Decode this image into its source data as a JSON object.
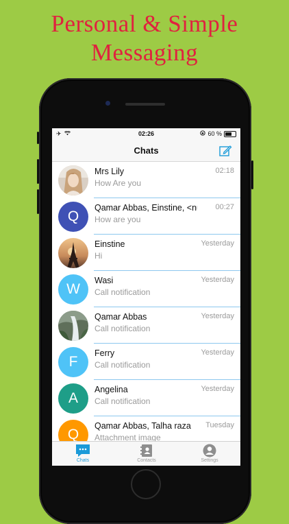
{
  "headline": {
    "line1": "Personal & Simple",
    "line2": "Messaging"
  },
  "status": {
    "time": "02:26",
    "battery": "60 %"
  },
  "nav": {
    "title": "Chats",
    "compose_icon": "compose-icon"
  },
  "chats": [
    {
      "name": "Mrs Lily",
      "time": "02:18",
      "message": "How Are you",
      "avatar_type": "photo-woman",
      "initial": ""
    },
    {
      "name": "Qamar Abbas, Einstine, <nul...",
      "time": "00:27",
      "message": "How are you",
      "avatar_type": "letter",
      "initial": "Q",
      "color": "#3f51b5"
    },
    {
      "name": "Einstine",
      "time": "Yesterday",
      "message": "Hi",
      "avatar_type": "photo-tower",
      "initial": ""
    },
    {
      "name": "Wasi",
      "time": "Yesterday",
      "message": "Call notification",
      "avatar_type": "letter",
      "initial": "W",
      "color": "#4fc3f7"
    },
    {
      "name": "Qamar Abbas",
      "time": "Yesterday",
      "message": "Call notification",
      "avatar_type": "photo-waterfall",
      "initial": ""
    },
    {
      "name": "Ferry",
      "time": "Yesterday",
      "message": "Call notification",
      "avatar_type": "letter",
      "initial": "F",
      "color": "#4fc3f7"
    },
    {
      "name": "Angelina",
      "time": "Yesterday",
      "message": "Call notification",
      "avatar_type": "letter",
      "initial": "A",
      "color": "#1e9e88"
    },
    {
      "name": "Qamar Abbas, Talha raza",
      "time": "Tuesday",
      "message": "Attachment image",
      "avatar_type": "letter",
      "initial": "Q",
      "color": "#ff9800"
    }
  ],
  "tabs": [
    {
      "label": "Chats",
      "icon": "chat-bubble-icon",
      "active": true
    },
    {
      "label": "Contacts",
      "icon": "contacts-book-icon",
      "active": false
    },
    {
      "label": "Settings",
      "icon": "person-circle-icon",
      "active": false
    }
  ],
  "colors": {
    "background": "#9dcb45",
    "headline": "#e0223f",
    "accent": "#1b9ad8"
  }
}
